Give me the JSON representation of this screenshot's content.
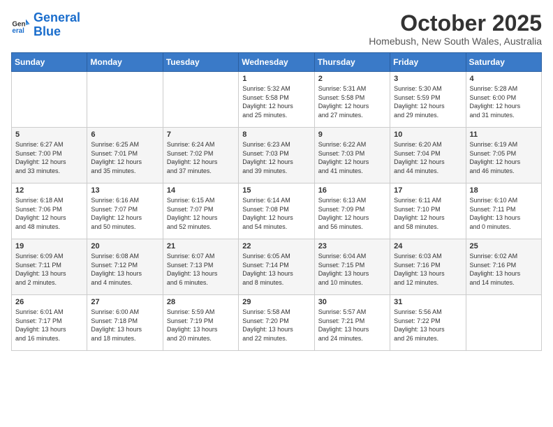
{
  "header": {
    "logo_line1": "General",
    "logo_line2": "Blue",
    "month_title": "October 2025",
    "subtitle": "Homebush, New South Wales, Australia"
  },
  "weekdays": [
    "Sunday",
    "Monday",
    "Tuesday",
    "Wednesday",
    "Thursday",
    "Friday",
    "Saturday"
  ],
  "weeks": [
    [
      {
        "day": "",
        "info": ""
      },
      {
        "day": "",
        "info": ""
      },
      {
        "day": "",
        "info": ""
      },
      {
        "day": "1",
        "info": "Sunrise: 5:32 AM\nSunset: 5:58 PM\nDaylight: 12 hours\nand 25 minutes."
      },
      {
        "day": "2",
        "info": "Sunrise: 5:31 AM\nSunset: 5:58 PM\nDaylight: 12 hours\nand 27 minutes."
      },
      {
        "day": "3",
        "info": "Sunrise: 5:30 AM\nSunset: 5:59 PM\nDaylight: 12 hours\nand 29 minutes."
      },
      {
        "day": "4",
        "info": "Sunrise: 5:28 AM\nSunset: 6:00 PM\nDaylight: 12 hours\nand 31 minutes."
      }
    ],
    [
      {
        "day": "5",
        "info": "Sunrise: 6:27 AM\nSunset: 7:00 PM\nDaylight: 12 hours\nand 33 minutes."
      },
      {
        "day": "6",
        "info": "Sunrise: 6:25 AM\nSunset: 7:01 PM\nDaylight: 12 hours\nand 35 minutes."
      },
      {
        "day": "7",
        "info": "Sunrise: 6:24 AM\nSunset: 7:02 PM\nDaylight: 12 hours\nand 37 minutes."
      },
      {
        "day": "8",
        "info": "Sunrise: 6:23 AM\nSunset: 7:03 PM\nDaylight: 12 hours\nand 39 minutes."
      },
      {
        "day": "9",
        "info": "Sunrise: 6:22 AM\nSunset: 7:03 PM\nDaylight: 12 hours\nand 41 minutes."
      },
      {
        "day": "10",
        "info": "Sunrise: 6:20 AM\nSunset: 7:04 PM\nDaylight: 12 hours\nand 44 minutes."
      },
      {
        "day": "11",
        "info": "Sunrise: 6:19 AM\nSunset: 7:05 PM\nDaylight: 12 hours\nand 46 minutes."
      }
    ],
    [
      {
        "day": "12",
        "info": "Sunrise: 6:18 AM\nSunset: 7:06 PM\nDaylight: 12 hours\nand 48 minutes."
      },
      {
        "day": "13",
        "info": "Sunrise: 6:16 AM\nSunset: 7:07 PM\nDaylight: 12 hours\nand 50 minutes."
      },
      {
        "day": "14",
        "info": "Sunrise: 6:15 AM\nSunset: 7:07 PM\nDaylight: 12 hours\nand 52 minutes."
      },
      {
        "day": "15",
        "info": "Sunrise: 6:14 AM\nSunset: 7:08 PM\nDaylight: 12 hours\nand 54 minutes."
      },
      {
        "day": "16",
        "info": "Sunrise: 6:13 AM\nSunset: 7:09 PM\nDaylight: 12 hours\nand 56 minutes."
      },
      {
        "day": "17",
        "info": "Sunrise: 6:11 AM\nSunset: 7:10 PM\nDaylight: 12 hours\nand 58 minutes."
      },
      {
        "day": "18",
        "info": "Sunrise: 6:10 AM\nSunset: 7:11 PM\nDaylight: 13 hours\nand 0 minutes."
      }
    ],
    [
      {
        "day": "19",
        "info": "Sunrise: 6:09 AM\nSunset: 7:11 PM\nDaylight: 13 hours\nand 2 minutes."
      },
      {
        "day": "20",
        "info": "Sunrise: 6:08 AM\nSunset: 7:12 PM\nDaylight: 13 hours\nand 4 minutes."
      },
      {
        "day": "21",
        "info": "Sunrise: 6:07 AM\nSunset: 7:13 PM\nDaylight: 13 hours\nand 6 minutes."
      },
      {
        "day": "22",
        "info": "Sunrise: 6:05 AM\nSunset: 7:14 PM\nDaylight: 13 hours\nand 8 minutes."
      },
      {
        "day": "23",
        "info": "Sunrise: 6:04 AM\nSunset: 7:15 PM\nDaylight: 13 hours\nand 10 minutes."
      },
      {
        "day": "24",
        "info": "Sunrise: 6:03 AM\nSunset: 7:16 PM\nDaylight: 13 hours\nand 12 minutes."
      },
      {
        "day": "25",
        "info": "Sunrise: 6:02 AM\nSunset: 7:16 PM\nDaylight: 13 hours\nand 14 minutes."
      }
    ],
    [
      {
        "day": "26",
        "info": "Sunrise: 6:01 AM\nSunset: 7:17 PM\nDaylight: 13 hours\nand 16 minutes."
      },
      {
        "day": "27",
        "info": "Sunrise: 6:00 AM\nSunset: 7:18 PM\nDaylight: 13 hours\nand 18 minutes."
      },
      {
        "day": "28",
        "info": "Sunrise: 5:59 AM\nSunset: 7:19 PM\nDaylight: 13 hours\nand 20 minutes."
      },
      {
        "day": "29",
        "info": "Sunrise: 5:58 AM\nSunset: 7:20 PM\nDaylight: 13 hours\nand 22 minutes."
      },
      {
        "day": "30",
        "info": "Sunrise: 5:57 AM\nSunset: 7:21 PM\nDaylight: 13 hours\nand 24 minutes."
      },
      {
        "day": "31",
        "info": "Sunrise: 5:56 AM\nSunset: 7:22 PM\nDaylight: 13 hours\nand 26 minutes."
      },
      {
        "day": "",
        "info": ""
      }
    ]
  ]
}
